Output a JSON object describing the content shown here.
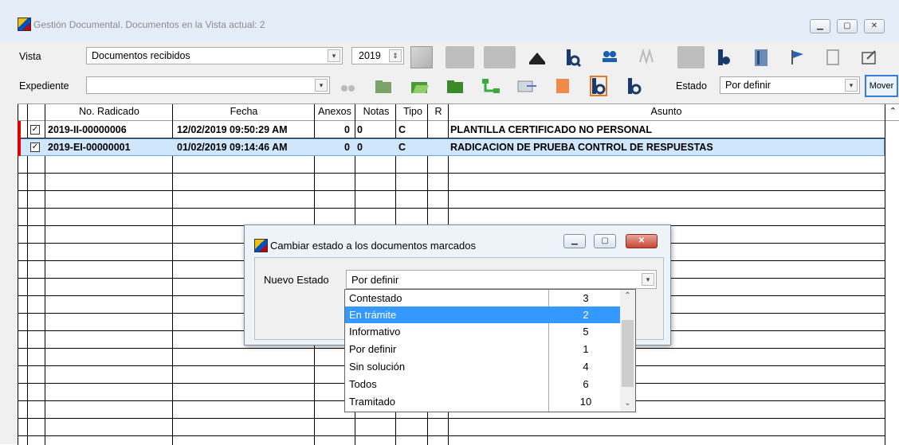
{
  "window": {
    "title": "Gestión Documental. Documentos en la Vista actual: 2",
    "buttons": {
      "minimize": "▭",
      "maximize": "▣",
      "close": "⤫"
    }
  },
  "toolbar": {
    "vista_label": "Vista",
    "vista_value": "Documentos recibidos",
    "year_value": "2019",
    "expediente_label": "Expediente",
    "expediente_value": "",
    "estado_label": "Estado",
    "estado_value": "Por definir",
    "mover_label": "Mover"
  },
  "grid": {
    "columns": [
      "No. Radicado",
      "Fecha",
      "Anexos",
      "Notas",
      "Tipo",
      "R",
      "Asunto"
    ],
    "rows": [
      {
        "checked": true,
        "radicado": "2019-II-00000006",
        "fecha": "12/02/2019 09:50:29 AM",
        "anexos": "0",
        "notas": "0",
        "tipo": "C",
        "r": "",
        "asunto": "PLANTILLA CERTIFICADO NO PERSONAL"
      },
      {
        "checked": true,
        "radicado": "2019-EI-00000001",
        "fecha": "01/02/2019 09:14:46 AM",
        "anexos": "0",
        "notas": "0",
        "tipo": "C",
        "r": "",
        "asunto": "RADICACION DE PRUEBA CONTROL DE RESPUESTAS"
      }
    ]
  },
  "dialog": {
    "title": "Cambiar estado a los documentos marcados",
    "nuevo_estado_label": "Nuevo Estado",
    "nuevo_estado_value": "Por definir",
    "options": [
      {
        "name": "Contestado",
        "count": "3"
      },
      {
        "name": "En trámite",
        "count": "2"
      },
      {
        "name": "Informativo",
        "count": "5"
      },
      {
        "name": "Por definir",
        "count": "1"
      },
      {
        "name": "Sin solución",
        "count": "4"
      },
      {
        "name": "Todos",
        "count": "6"
      },
      {
        "name": "Tramitado",
        "count": "10"
      }
    ],
    "selected_option": "En trámite"
  },
  "icons": {
    "arrow": "⌄",
    "up": "⌃",
    "check": "✓"
  },
  "colors": {
    "selection": "#3399ff",
    "row_highlight": "#cfe6fb",
    "marker": "#e00000"
  }
}
